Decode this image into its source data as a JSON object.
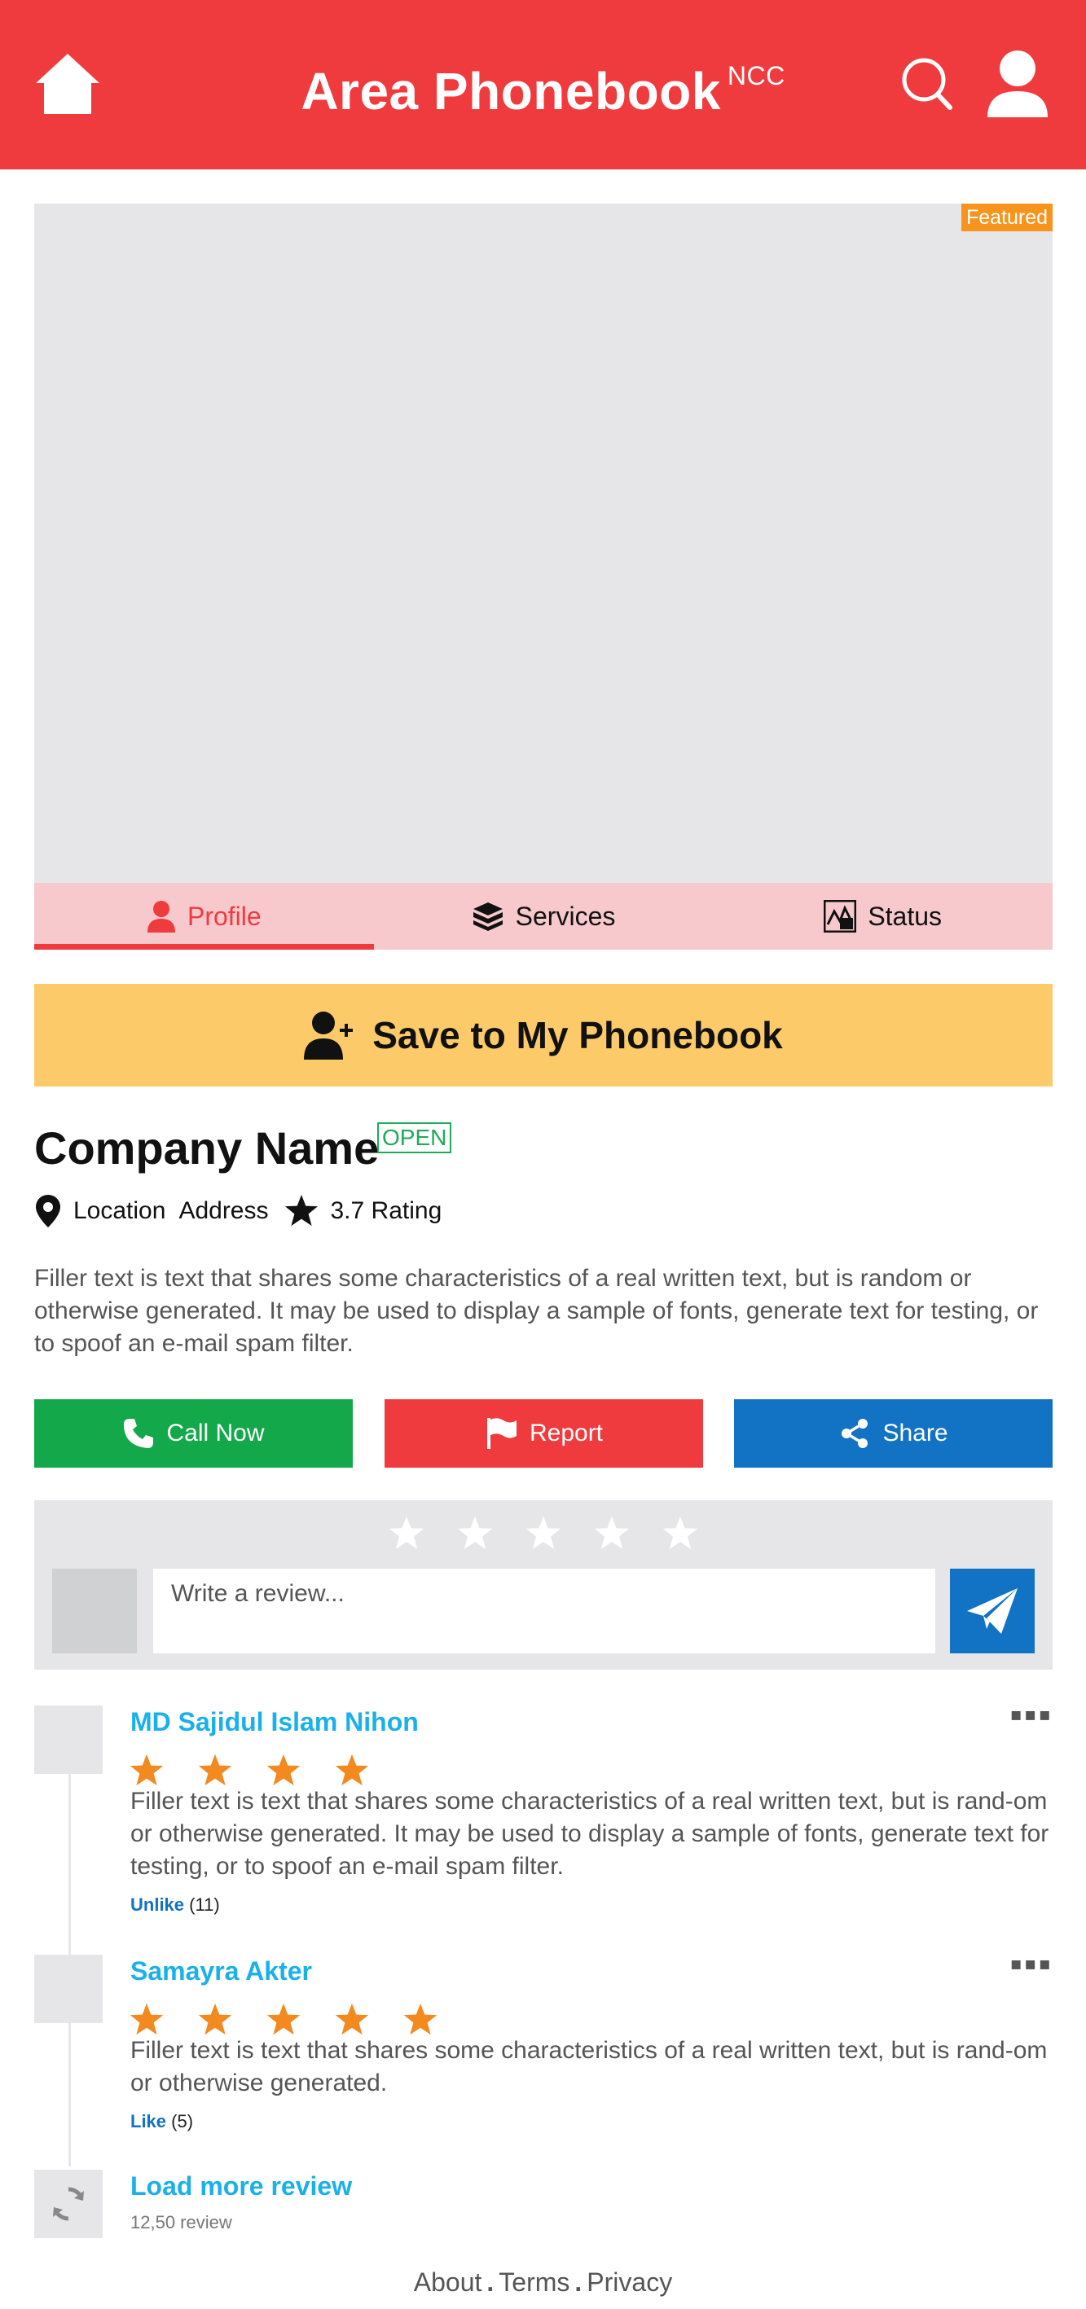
{
  "header": {
    "title": "Area Phonebook",
    "title_sup": "NCC",
    "home_icon": "home-icon",
    "search_icon": "search-icon",
    "user_icon": "user-icon",
    "brand_color": "#ef3b3e"
  },
  "hero": {
    "featured_label": "Featured"
  },
  "tabs": [
    {
      "label": "Profile",
      "icon": "person-icon",
      "active": true
    },
    {
      "label": "Services",
      "icon": "box-icon",
      "active": false
    },
    {
      "label": "Status",
      "icon": "status-icon",
      "active": false
    }
  ],
  "save_button": {
    "label": "Save to My Phonebook",
    "icon": "add-user-icon"
  },
  "company": {
    "name": "Company Name",
    "status": "OPEN",
    "location": "Location",
    "address": "Address",
    "rating": "3.7 Rating",
    "description": "Filler text is text that shares some characteristics of a real written text, but is random or otherwise generated. It may be used to display a sample of fonts, generate text for testing, or to spoof an e-mail spam filter."
  },
  "actions": {
    "call": "Call Now",
    "report": "Report",
    "share": "Share",
    "colors": {
      "call": "#13a84a",
      "report": "#ef3b3e",
      "share": "#1272c3"
    }
  },
  "review_form": {
    "placeholder": "Write a review...",
    "star_count": 5
  },
  "reviews": [
    {
      "name": "MD Sajidul Islam Nihon",
      "stars": 4,
      "text": "Filler text is text that shares some characteristics of a real written text, but is rand-om or otherwise generated. It may be used to display a sample of fonts, generate text for testing, or to spoof an e-mail spam filter.",
      "like_label": "Unlike",
      "like_count": "(11)"
    },
    {
      "name": "Samayra Akter",
      "stars": 5,
      "text": "Filler text is text that shares some characteristics of a real written text, but is rand-om or otherwise generated.",
      "like_label": "Like",
      "like_count": "(5)"
    }
  ],
  "load_more": {
    "label": "Load more review",
    "count": "12,50 review"
  },
  "footer": {
    "about": "About",
    "terms": "Terms",
    "privacy": "Privacy"
  }
}
